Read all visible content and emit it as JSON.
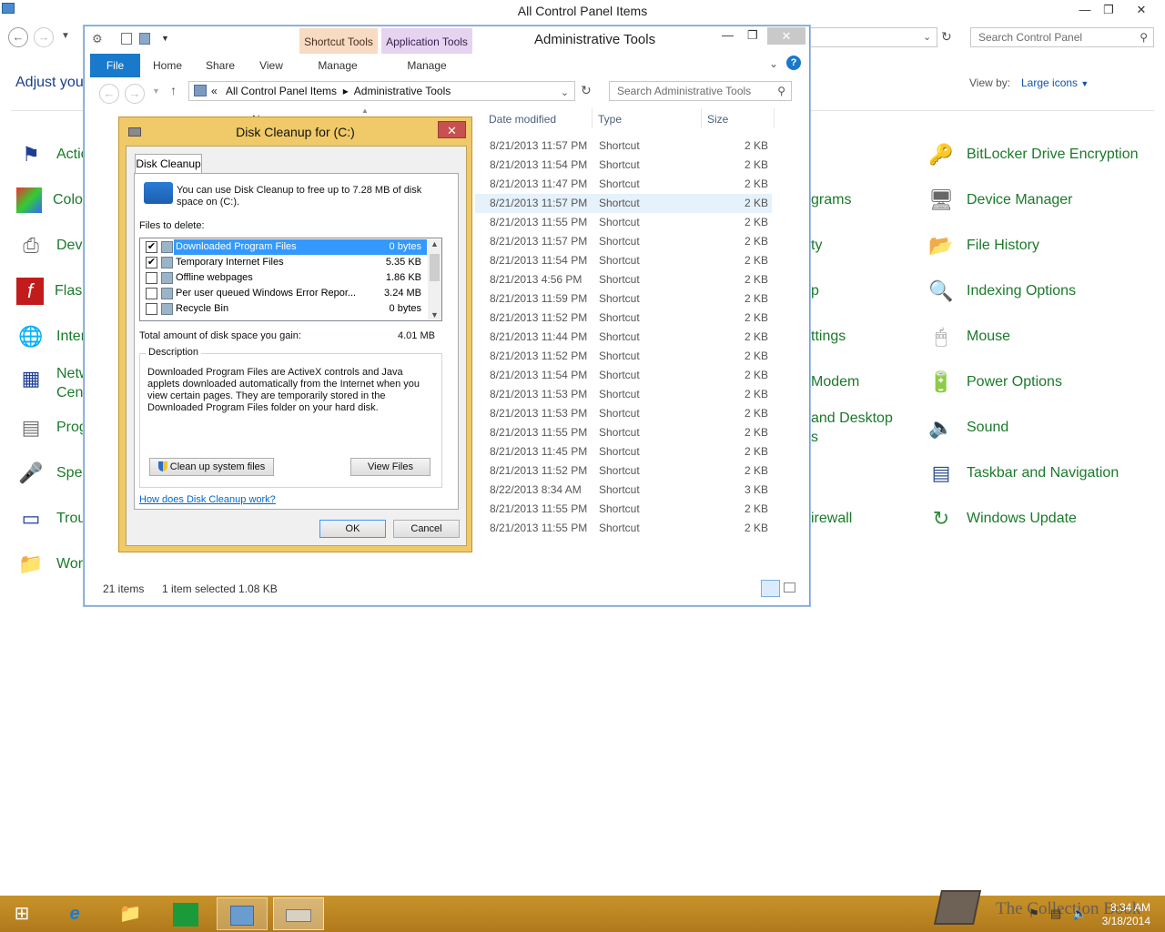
{
  "control_panel": {
    "title": "All Control Panel Items",
    "search_placeholder": "Search Control Panel",
    "heading": "Adjust you",
    "view_by_label": "View by:",
    "view_by_value": "Large icons",
    "left_items": [
      "Actio",
      "Colo",
      "Devi",
      "Flash",
      "Inter",
      "Netw",
      "Cent",
      "Prog",
      "Spee",
      "Trou",
      "Wor"
    ],
    "mid_items": [
      "grams",
      "ty",
      "p",
      "ttings",
      "Modem",
      "and Desktop",
      "s",
      "irewall"
    ],
    "right_items": [
      "BitLocker Drive Encryption",
      "Device Manager",
      "File History",
      "Indexing Options",
      "Mouse",
      "Power Options",
      "Sound",
      "Taskbar and Navigation",
      "Windows Update"
    ]
  },
  "explorer": {
    "title": "Administrative Tools",
    "context_tab_1": "Shortcut Tools",
    "context_tab_2": "Application Tools",
    "tabs": {
      "file": "File",
      "home": "Home",
      "share": "Share",
      "view": "View",
      "manage1": "Manage",
      "manage2": "Manage"
    },
    "breadcrumb_sep": "«",
    "breadcrumb_1": "All Control Panel Items",
    "breadcrumb_2": "Administrative Tools",
    "search_placeholder": "Search Administrative Tools",
    "columns": {
      "name": "N",
      "date": "Date modified",
      "type": "Type",
      "size": "Size"
    },
    "rows": [
      {
        "date": "8/21/2013 11:57 PM",
        "type": "Shortcut",
        "size": "2 KB"
      },
      {
        "date": "8/21/2013 11:54 PM",
        "type": "Shortcut",
        "size": "2 KB"
      },
      {
        "date": "8/21/2013 11:47 PM",
        "type": "Shortcut",
        "size": "2 KB"
      },
      {
        "date": "8/21/2013 11:57 PM",
        "type": "Shortcut",
        "size": "2 KB"
      },
      {
        "date": "8/21/2013 11:55 PM",
        "type": "Shortcut",
        "size": "2 KB"
      },
      {
        "date": "8/21/2013 11:57 PM",
        "type": "Shortcut",
        "size": "2 KB"
      },
      {
        "date": "8/21/2013 11:54 PM",
        "type": "Shortcut",
        "size": "2 KB"
      },
      {
        "date": "8/21/2013 4:56 PM",
        "type": "Shortcut",
        "size": "2 KB"
      },
      {
        "date": "8/21/2013 11:59 PM",
        "type": "Shortcut",
        "size": "2 KB"
      },
      {
        "date": "8/21/2013 11:52 PM",
        "type": "Shortcut",
        "size": "2 KB"
      },
      {
        "date": "8/21/2013 11:44 PM",
        "type": "Shortcut",
        "size": "2 KB"
      },
      {
        "date": "8/21/2013 11:52 PM",
        "type": "Shortcut",
        "size": "2 KB"
      },
      {
        "date": "8/21/2013 11:54 PM",
        "type": "Shortcut",
        "size": "2 KB"
      },
      {
        "date": "8/21/2013 11:53 PM",
        "type": "Shortcut",
        "size": "2 KB"
      },
      {
        "date": "8/21/2013 11:53 PM",
        "type": "Shortcut",
        "size": "2 KB"
      },
      {
        "date": "8/21/2013 11:55 PM",
        "type": "Shortcut",
        "size": "2 KB"
      },
      {
        "date": "8/21/2013 11:45 PM",
        "type": "Shortcut",
        "size": "2 KB"
      },
      {
        "date": "8/21/2013 11:52 PM",
        "type": "Shortcut",
        "size": "2 KB"
      },
      {
        "date": "8/22/2013 8:34 AM",
        "type": "Shortcut",
        "size": "3 KB"
      },
      {
        "date": "8/21/2013 11:55 PM",
        "type": "Shortcut",
        "size": "2 KB"
      },
      {
        "date": "8/21/2013 11:55 PM",
        "type": "Shortcut",
        "size": "2 KB"
      }
    ],
    "status_count": "21 items",
    "status_selected": "1 item selected  1.08 KB"
  },
  "dialog": {
    "title": "Disk Cleanup for  (C:)",
    "tab": "Disk Cleanup",
    "intro": "You can use Disk Cleanup to free up to 7.28 MB of disk space on  (C:).",
    "files_label": "Files to delete:",
    "files": [
      {
        "name": "Downloaded Program Files",
        "size": "0 bytes",
        "checked": "✔"
      },
      {
        "name": "Temporary Internet Files",
        "size": "5.35 KB",
        "checked": "✔"
      },
      {
        "name": "Offline webpages",
        "size": "1.86 KB",
        "checked": ""
      },
      {
        "name": "Per user queued Windows Error Repor...",
        "size": "3.24 MB",
        "checked": ""
      },
      {
        "name": "Recycle Bin",
        "size": "0 bytes",
        "checked": ""
      }
    ],
    "total_label": "Total amount of disk space you gain:",
    "total_value": "4.01 MB",
    "description_label": "Description",
    "description": "Downloaded Program Files are ActiveX controls and Java applets downloaded automatically from the Internet when you view certain pages. They are temporarily stored in the Downloaded Program Files folder on your hard disk.",
    "cleanup_button": "Clean up system files",
    "view_files_button": "View Files",
    "help_link": "How does Disk Cleanup work?",
    "ok_button": "OK",
    "cancel_button": "Cancel"
  },
  "taskbar": {
    "watermark": "The Collection Book",
    "time": "8:34 AM",
    "date": "3/18/2014"
  }
}
